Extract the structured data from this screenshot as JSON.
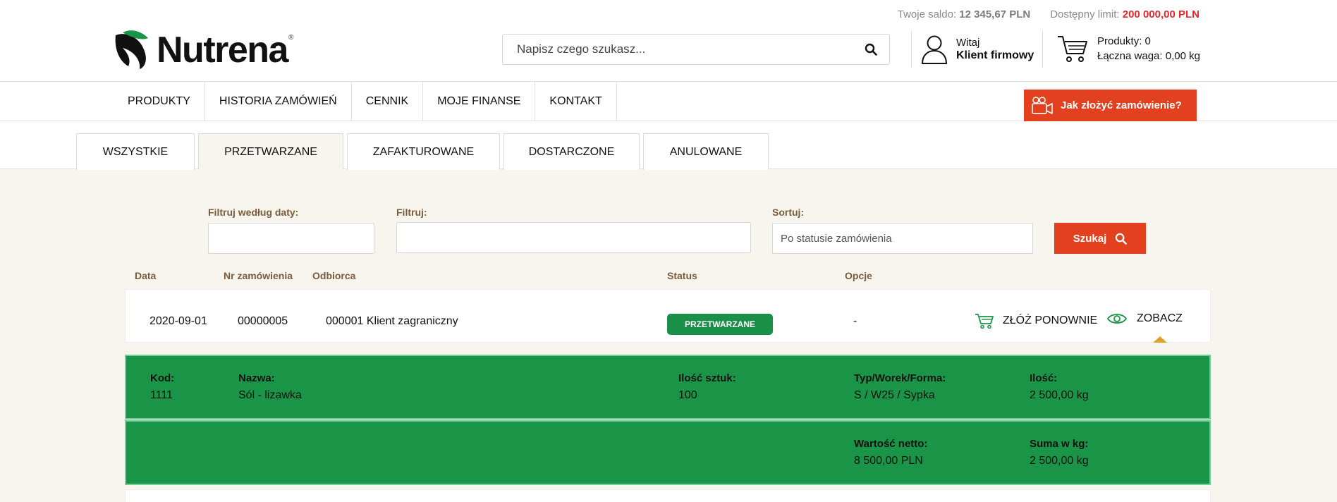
{
  "header": {
    "balance_label": "Twoje saldo:",
    "balance_value": "12 345,67 PLN",
    "limit_label": "Dostępny limit:",
    "limit_value": "200 000,00 PLN",
    "logo_text": "Nutrena",
    "logo_mark": "®",
    "search_placeholder": "Napisz czego szukasz...",
    "account_greeting": "Witaj",
    "account_name": "Klient firmowy",
    "cart_products": "Produkty: 0",
    "cart_weight": "Łączna waga: 0,00 kg"
  },
  "nav": {
    "items": [
      {
        "label": "PRODUKTY"
      },
      {
        "label": "HISTORIA ZAMÓWIEŃ"
      },
      {
        "label": "CENNIK"
      },
      {
        "label": "MOJE FINANSE"
      },
      {
        "label": "KONTAKT"
      }
    ],
    "howto_label": "Jak złożyć zamówienie?"
  },
  "tabs": [
    {
      "label": "WSZYSTKIE",
      "active": false
    },
    {
      "label": "PRZETWARZANE",
      "active": true
    },
    {
      "label": "ZAFAKTUROWANE",
      "active": false
    },
    {
      "label": "DOSTARCZONE",
      "active": false
    },
    {
      "label": "ANULOWANE",
      "active": false
    }
  ],
  "filters": {
    "date_label": "Filtruj według daty:",
    "date_value": "",
    "filter_label": "Filtruj:",
    "filter_value": "",
    "sort_label": "Sortuj:",
    "sort_placeholder": "Po statusie zamówienia",
    "search_button": "Szukaj"
  },
  "table": {
    "headers": {
      "date": "Data",
      "order_no": "Nr zamówienia",
      "recipient": "Odbiorca",
      "status": "Status",
      "options": "Opcje"
    },
    "orders": [
      {
        "date": "2020-09-01",
        "order_no": "00000005",
        "recipient": "000001 Klient zagraniczny",
        "status": "PRZETWARZANE",
        "options": "-",
        "reorder_label": "ZŁÓŻ PONOWNIE",
        "view_label": "ZOBACZ",
        "details": {
          "code_label": "Kod:",
          "code": "1111",
          "name_label": "Nazwa:",
          "name": "Sól - lizawka",
          "qty_label": "Ilość sztuk:",
          "qty": "100",
          "type_label": "Typ/Worek/Forma:",
          "type": "S / W25 / Sypka",
          "amount_label": "Ilość:",
          "amount": "2 500,00 kg",
          "net_label": "Wartość netto:",
          "net": "8 500,00 PLN",
          "sum_label": "Suma w kg:",
          "sum": "2 500,00 kg"
        }
      }
    ]
  },
  "colors": {
    "accent_red": "#e2401f",
    "status_green": "#1a8f47",
    "label_brown": "#7a5c3a",
    "limit_red": "#e5262b",
    "background": "#f8f4ee"
  },
  "icons": [
    "logo-leaf-icon",
    "search-icon",
    "user-icon",
    "cart-icon",
    "video-camera-icon",
    "cart-reorder-icon",
    "eye-icon"
  ]
}
